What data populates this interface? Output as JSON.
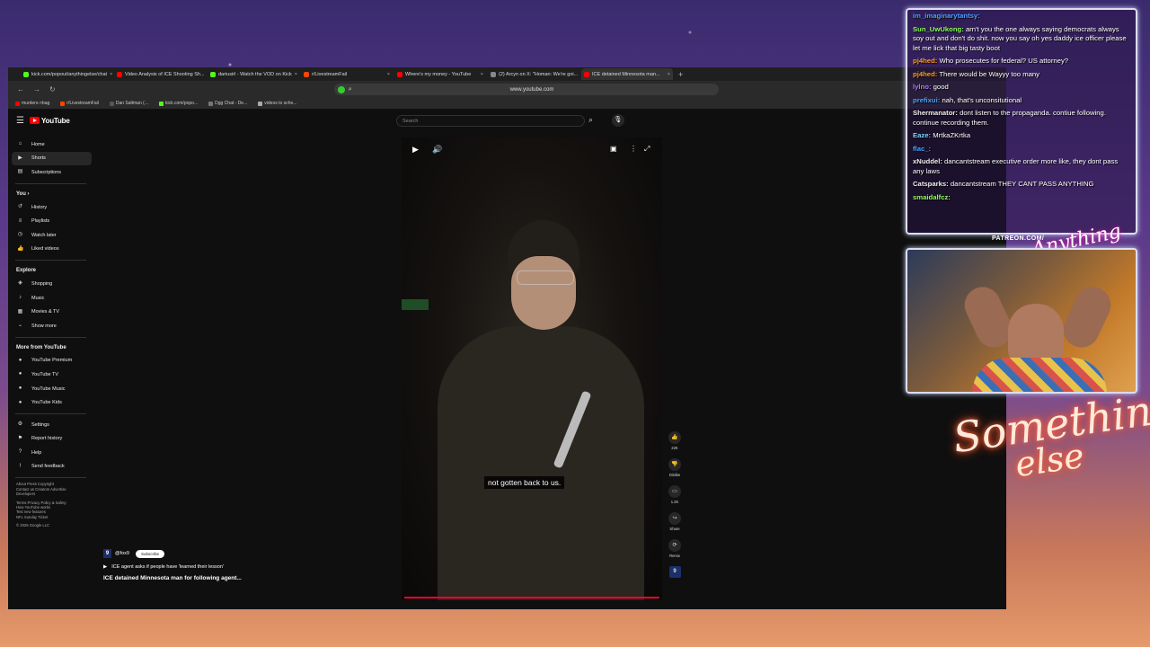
{
  "browser": {
    "tabs": [
      {
        "label": "kick.com/popout/anythingelse/chat",
        "color": "#53fc18",
        "active": false
      },
      {
        "label": "Video Analysis of ICE Shooting Sh...",
        "color": "#ff0000",
        "active": false
      },
      {
        "label": "dariusirl - Watch the VOD on Kick",
        "color": "#53fc18",
        "active": false
      },
      {
        "label": "r/LivestreamFail",
        "color": "#ff4500",
        "active": false
      },
      {
        "label": "Where's my money - YouTube",
        "color": "#ff0000",
        "active": false
      },
      {
        "label": "(2) Arcyn on X: \"Homan: We're goi...",
        "color": "#888888",
        "active": false
      },
      {
        "label": "ICE detained Minnesota man...",
        "color": "#ff0000",
        "active": true
      }
    ],
    "url": "www.youtube.com",
    "bookmarks": [
      {
        "label": "murders->bag",
        "color": "#ff0000"
      },
      {
        "label": "r/LivestreamFail",
        "color": "#ff4500"
      },
      {
        "label": "Dan Saltman (...",
        "color": "#555555"
      },
      {
        "label": "kick.com/popo...",
        "color": "#53fc18"
      },
      {
        "label": "Dgg Chat - De...",
        "color": "#777777"
      },
      {
        "label": "videos to sche...",
        "color": "#aaaaaa"
      }
    ]
  },
  "youtube": {
    "logo": "YouTube",
    "search_placeholder": "Search",
    "nav_main": [
      {
        "label": "Home",
        "icon": "home-icon",
        "glyph": "⌂"
      },
      {
        "label": "Shorts",
        "icon": "shorts-icon",
        "glyph": "▶",
        "active": true
      },
      {
        "label": "Subscriptions",
        "icon": "subscriptions-icon",
        "glyph": "▤"
      }
    ],
    "you_header": "You ›",
    "nav_you": [
      {
        "label": "History",
        "icon": "history-icon",
        "glyph": "↺"
      },
      {
        "label": "Playlists",
        "icon": "playlists-icon",
        "glyph": "≡"
      },
      {
        "label": "Watch later",
        "icon": "clock-icon",
        "glyph": "◷"
      },
      {
        "label": "Liked videos",
        "icon": "thumbs-up-icon",
        "glyph": "👍"
      }
    ],
    "explore_header": "Explore",
    "nav_explore": [
      {
        "label": "Shopping",
        "icon": "shopping-icon",
        "glyph": "◈"
      },
      {
        "label": "Music",
        "icon": "music-icon",
        "glyph": "♪"
      },
      {
        "label": "Movies & TV",
        "icon": "movies-icon",
        "glyph": "▦"
      },
      {
        "label": "Show more",
        "icon": "chevron-down-icon",
        "glyph": "⌄"
      }
    ],
    "more_header": "More from YouTube",
    "nav_more": [
      {
        "label": "YouTube Premium",
        "icon": "yt-premium-icon",
        "glyph": "●"
      },
      {
        "label": "YouTube TV",
        "icon": "yt-tv-icon",
        "glyph": "●"
      },
      {
        "label": "YouTube Music",
        "icon": "yt-music-icon",
        "glyph": "●"
      },
      {
        "label": "YouTube Kids",
        "icon": "yt-kids-icon",
        "glyph": "●"
      }
    ],
    "nav_settings": [
      {
        "label": "Settings",
        "icon": "gear-icon",
        "glyph": "⚙"
      },
      {
        "label": "Report history",
        "icon": "flag-icon",
        "glyph": "⚑"
      },
      {
        "label": "Help",
        "icon": "help-icon",
        "glyph": "?"
      },
      {
        "label": "Send feedback",
        "icon": "feedback-icon",
        "glyph": "!"
      }
    ],
    "footer_lines": [
      "About  Press  Copyright",
      "Contact us  Creators  Advertise",
      "Developers",
      "",
      "Terms  Privacy  Policy & Safety",
      "How YouTube works",
      "Test new features",
      "NFL Sunday Ticket",
      "",
      "© 2026 Google LLC"
    ]
  },
  "short": {
    "caption": "not gotten back to us.",
    "channel": "@fox9",
    "subscribe": "Subscribe",
    "channel_badge": "9",
    "linked_video": "ICE agent asks if people have 'learned their lesson'",
    "title": "ICE detained Minnesota man for following agent...",
    "actions": [
      {
        "label": "22K",
        "icon": "like-icon",
        "glyph": "👍"
      },
      {
        "label": "Dislike",
        "icon": "dislike-icon",
        "glyph": "👎"
      },
      {
        "label": "1.2K",
        "icon": "comment-icon",
        "glyph": "▭"
      },
      {
        "label": "Share",
        "icon": "share-icon",
        "glyph": "↪"
      },
      {
        "label": "Remix",
        "icon": "remix-icon",
        "glyph": "⟳"
      }
    ]
  },
  "chat": {
    "messages": [
      {
        "user": "im_imaginarytantsy:",
        "text": "",
        "color": "#4aa3ff"
      },
      {
        "user": "Sun_UwUkong:",
        "text": "arn't you the one always saying democrats always soy out and don't do shit. now you say oh yes daddy ice officer please let me lick that big tasty boot",
        "color": "#8cff5a"
      },
      {
        "user": "pj4hed:",
        "text": "Who prosecutes for federal? US attorney?",
        "color": "#ff9a2a"
      },
      {
        "user": "pj4hed:",
        "text": "There would be Wayyy too many",
        "color": "#ff9a2a"
      },
      {
        "user": "lylno:",
        "text": "good",
        "color": "#b07bff"
      },
      {
        "user": "prefixui:",
        "text": "nah, that's unconsitutional",
        "color": "#4aa3ff"
      },
      {
        "user": "Shermanator:",
        "text": "dont listen to the propaganda. contiue following. continue recording them.",
        "color": "#eeeeee"
      },
      {
        "user": "Eaze:",
        "text": "MrtkaZKrtka",
        "color": "#7ad7ff"
      },
      {
        "user": "flac_:",
        "text": "",
        "color": "#4aa3ff"
      },
      {
        "user": "xNuddel:",
        "text": "dancantstream executive order more like, they dont pass any laws",
        "color": "#eeeeee"
      },
      {
        "user": "Catsparks:",
        "text": "dancantstream THEY CANT PASS ANYTHING",
        "color": "#eeeeee"
      },
      {
        "user": "smaidalfcz:",
        "text": "",
        "color": "#8cff5a"
      }
    ]
  },
  "overlay": {
    "patreon": "PATREON.COM/",
    "signature": "Anything else",
    "neon_line1": "Something",
    "neon_line2": "else"
  }
}
